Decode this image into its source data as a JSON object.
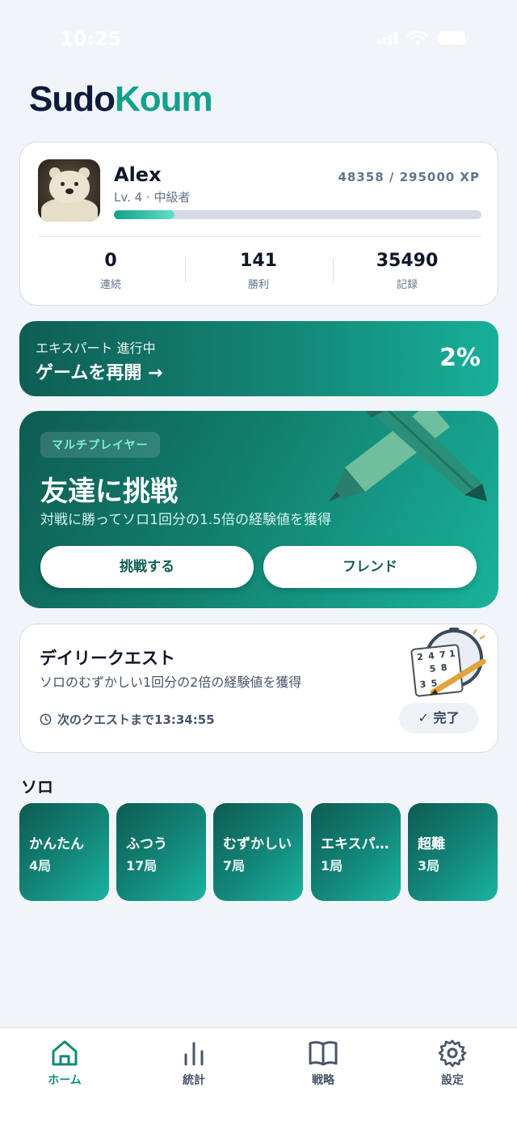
{
  "status": {
    "time": "10:25"
  },
  "app": {
    "name_part1": "Sudo",
    "name_part2": "Koum"
  },
  "profile": {
    "name": "Alex",
    "level": "Lv. 4 · 中級者",
    "xp_text": "48358 / 295000 XP",
    "xp_fraction": 0.164,
    "stats": [
      {
        "value": "0",
        "label": "連続"
      },
      {
        "value": "141",
        "label": "勝利"
      },
      {
        "value": "35490",
        "label": "記録"
      }
    ]
  },
  "resume": {
    "subtitle": "エキスパート 進行中",
    "action": "ゲームを再開 →",
    "progress": "2%"
  },
  "multiplayer": {
    "badge": "マルチプレイヤー",
    "title": "友達に挑戦",
    "description": "対戦に勝ってソロ1回分の1.5倍の経験値を獲得",
    "challenge_button": "挑戦する",
    "friends_button": "フレンド"
  },
  "daily": {
    "title": "デイリークエスト",
    "description": "ソロのむずかしい1回分の2倍の経験値を獲得",
    "timer": "次のクエストまで13:34:55",
    "status_button": "✓ 完了"
  },
  "solo": {
    "title": "ソロ",
    "levels": [
      {
        "name": "かんたん",
        "count": "4局"
      },
      {
        "name": "ふつう",
        "count": "17局"
      },
      {
        "name": "むずかしい",
        "count": "7局"
      },
      {
        "name": "エキスパ…",
        "count": "1局"
      },
      {
        "name": "超難",
        "count": "3局"
      }
    ]
  },
  "nav": {
    "items": [
      {
        "label": "ホーム",
        "icon": "home-icon",
        "active": true
      },
      {
        "label": "統計",
        "icon": "bar-chart-icon",
        "active": false
      },
      {
        "label": "戦略",
        "icon": "book-icon",
        "active": false
      },
      {
        "label": "設定",
        "icon": "gear-icon",
        "active": false
      }
    ],
    "accent": "#128a79"
  },
  "colors": {
    "brand_dark": "#0f1b3d",
    "brand_accent": "#14a08a"
  }
}
